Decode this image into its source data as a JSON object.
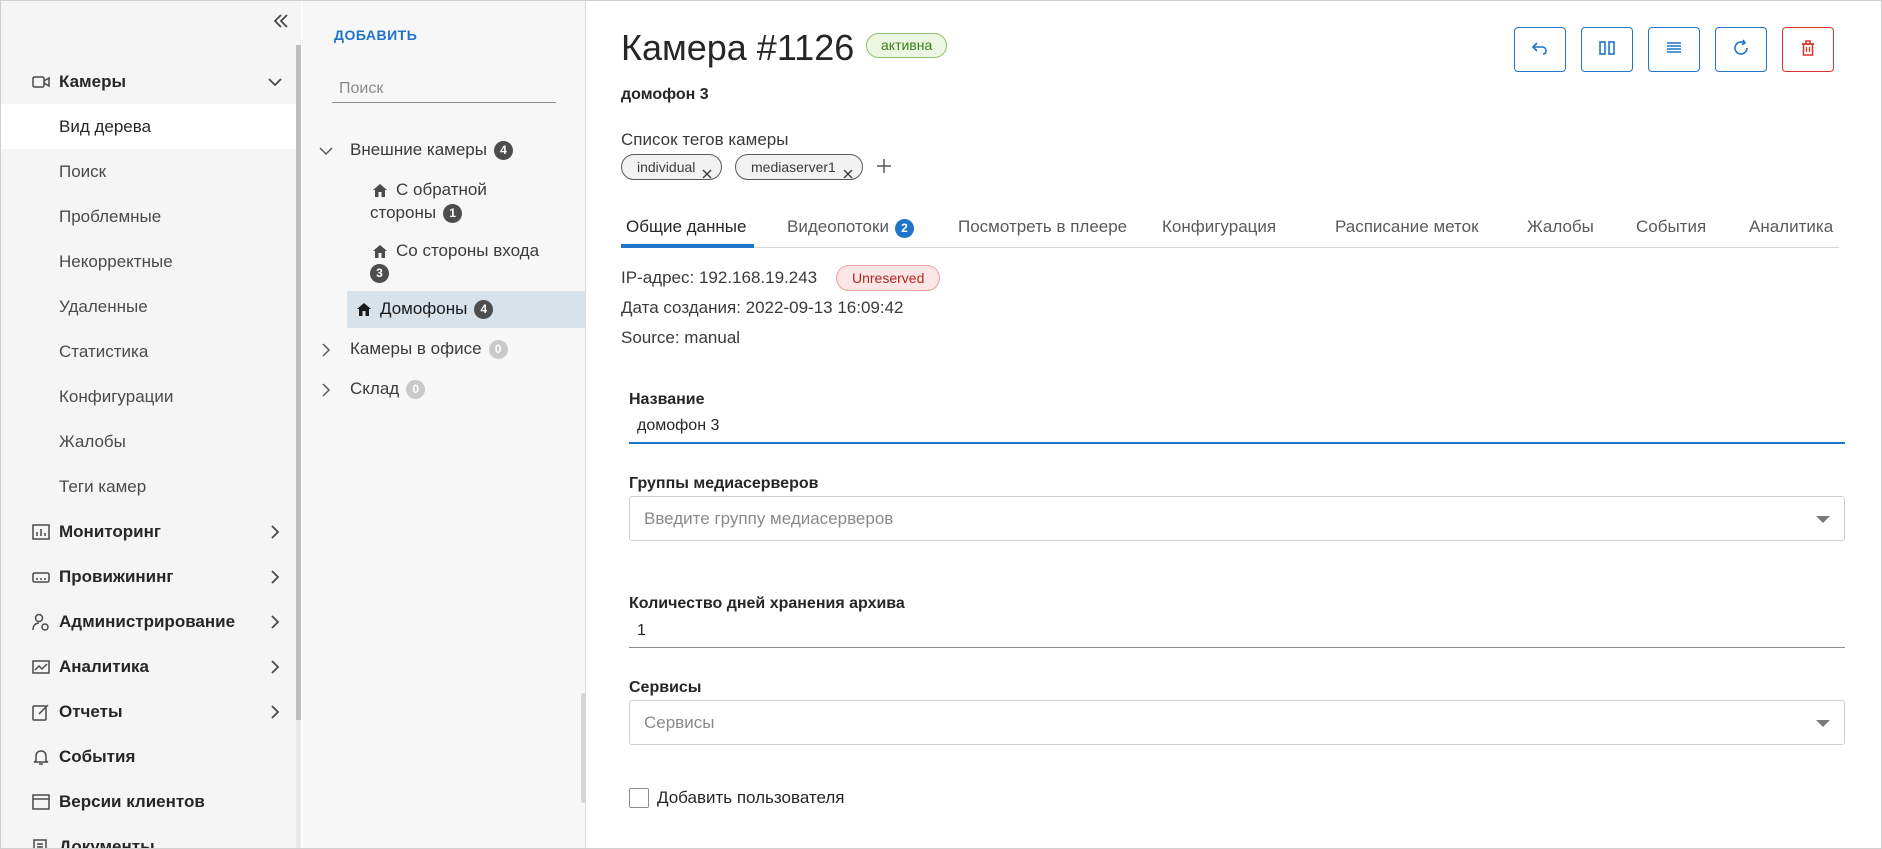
{
  "sidebar": {
    "menu": [
      {
        "label": "Камеры",
        "icon": "camera-icon",
        "expanded": true
      },
      {
        "label": "Мониторинг",
        "icon": "monitoring-icon"
      },
      {
        "label": "Провижининг",
        "icon": "provisioning-icon"
      },
      {
        "label": "Администрирование",
        "icon": "admin-icon"
      },
      {
        "label": "Аналитика",
        "icon": "analytics-icon"
      },
      {
        "label": "Отчеты",
        "icon": "reports-icon"
      },
      {
        "label": "События",
        "icon": "bell-icon"
      },
      {
        "label": "Версии клиентов",
        "icon": "window-icon"
      },
      {
        "label": "Документы",
        "icon": "documents-icon"
      }
    ],
    "cameras_sub": [
      {
        "label": "Вид дерева",
        "active": true
      },
      {
        "label": "Поиск"
      },
      {
        "label": "Проблемные"
      },
      {
        "label": "Некорректные"
      },
      {
        "label": "Удаленные"
      },
      {
        "label": "Статистика"
      },
      {
        "label": "Конфигурации"
      },
      {
        "label": "Жалобы"
      },
      {
        "label": "Теги камер"
      }
    ]
  },
  "tree": {
    "add_label": "ДОБАВИТЬ",
    "search_placeholder": "Поиск",
    "nodes": [
      {
        "label": "Внешние камеры",
        "count": "4"
      },
      {
        "label_line1": "С обратной",
        "label_line2": "стороны",
        "count": "1"
      },
      {
        "label": "Со стороны входа",
        "count": "3"
      },
      {
        "label": "Домофоны",
        "count": "4",
        "selected": true
      },
      {
        "label": "Камеры в офисе",
        "count": "0"
      },
      {
        "label": "Склад",
        "count": "0"
      }
    ]
  },
  "camera": {
    "title": "Камера #1126",
    "status": "активна",
    "subtitle": "домофон 3",
    "tags_label": "Список тегов камеры",
    "tags": [
      "individual",
      "mediaserver1"
    ],
    "tabs": [
      {
        "label": "Общие данные",
        "active": true
      },
      {
        "label": "Видеопотоки",
        "count": "2"
      },
      {
        "label": "Посмотреть в плеере"
      },
      {
        "label": "Конфигурация"
      },
      {
        "label": "Расписание меток"
      },
      {
        "label": "Жалобы"
      },
      {
        "label": "События"
      },
      {
        "label": "Аналитика"
      }
    ],
    "ip_line": "IP-адрес: 192.168.19.243",
    "ip_badge": "Unreserved",
    "created_line": "Дата создания: 2022-09-13 16:09:42",
    "source_line": "Source: manual"
  },
  "form": {
    "name_label": "Название",
    "name_value": "домофон 3",
    "groups_label": "Группы медиасерверов",
    "groups_placeholder": "Введите группу медиасерверов",
    "days_label": "Количество дней хранения архива",
    "days_value": "1",
    "services_label": "Сервисы",
    "services_placeholder": "Сервисы",
    "add_user_label": "Добавить пользователя"
  },
  "colors": {
    "accent": "#1f74c9",
    "danger": "#d9342b",
    "active_green": "#3a7d13",
    "unreserved_red": "#b3261e"
  }
}
